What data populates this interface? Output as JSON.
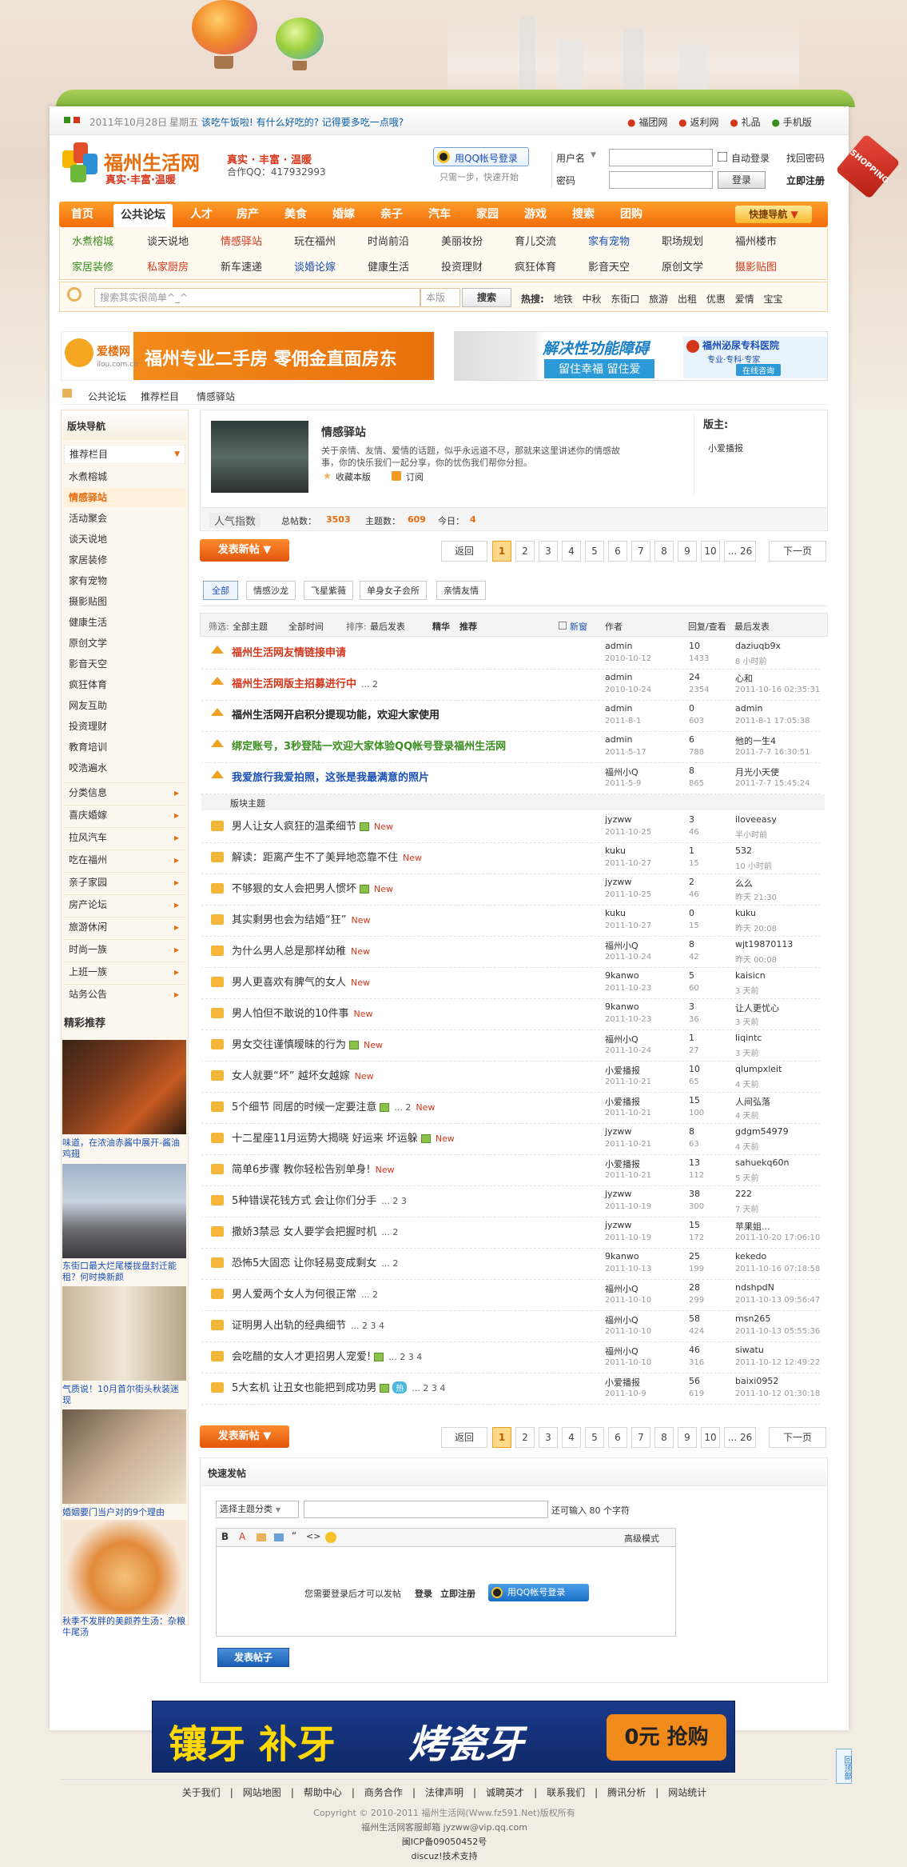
{
  "topbar": {
    "date": "2011年10月28日",
    "weekday": "星期五",
    "prompt": "该吃午饭啦! 有什么好吃的? 记得要多吃一点哦?",
    "links": [
      "福团网",
      "返利网",
      "礼品",
      "手机版"
    ]
  },
  "logo": {
    "name": "福州生活网",
    "slogan": "真实·丰富·温暖",
    "tagline": "真实 · 丰富 · 温暖",
    "qq": "合作QQ：417932993"
  },
  "qqlogin": {
    "label": "用QQ帐号登录",
    "sub": "只需一步，快速开始"
  },
  "login": {
    "username_label": "用户名",
    "password_label": "密码",
    "auto_login": "自动登录",
    "retrieve": "找回密码",
    "login_btn": "登录",
    "register": "立即注册"
  },
  "shopping_tag": "SHOPPING",
  "nav": {
    "tabs": [
      "首页",
      "公共论坛",
      "人才",
      "房产",
      "美食",
      "婚嫁",
      "亲子",
      "汽车",
      "家园",
      "游戏",
      "搜索",
      "团购"
    ],
    "quick": "快捷导航"
  },
  "subnav": [
    [
      "水煮榕城",
      "谈天说地",
      "情感驿站",
      "玩在福州",
      "时尚前沿",
      "美丽妆扮",
      "育儿交流",
      "家有宠物",
      "职场规划",
      "福州楼市"
    ],
    [
      "家居装修",
      "私家厨房",
      "新车速递",
      "谈婚论嫁",
      "健康生活",
      "投资理财",
      "疯狂体育",
      "影音天空",
      "原创文学",
      "摄影贴图"
    ]
  ],
  "search": {
    "placeholder": "搜索其实很简单^_^",
    "type": "本版",
    "button": "搜索",
    "hot_label": "热搜:",
    "hot": [
      "地铁",
      "中秋",
      "东街口",
      "旅游",
      "出租",
      "优惠",
      "爱情",
      "宝宝"
    ]
  },
  "ads": {
    "left_brand": "爱楼网",
    "left_domain": "ilou.com.cn",
    "left_text": "福州专业二手房 零佣金直面房东",
    "mid_text": "解决性功能障碍",
    "mid_sub": "留住幸福 留住爱",
    "right_text": "福州泌尿专科医院",
    "right_sub": "专业·专科·专家",
    "right_btn": "在线咨询"
  },
  "breadcrumb": [
    "公共论坛",
    "推荐栏目",
    "情感驿站"
  ],
  "sidebar": {
    "title": "版块导航",
    "group": "推荐栏目",
    "items": [
      "水煮榕城",
      "情感驿站",
      "活动聚会",
      "谈天说地",
      "家居装修",
      "家有宠物",
      "摄影贴图",
      "健康生活",
      "原创文学",
      "影音天空",
      "疯狂体育",
      "网友互助",
      "投资理财",
      "教育培训",
      "咬浩遍水"
    ],
    "groups": [
      "分类信息",
      "喜庆婚嫁",
      "拉风汽车",
      "吃在福州",
      "亲子家园",
      "房产论坛",
      "旅游休闲",
      "时尚一族",
      "上班一族",
      "站务公告"
    ],
    "featured_title": "精彩推荐",
    "featured": [
      "味道，在浓油赤酱中展开-酱油鸡翅",
      "东街口最大烂尾楼拢盘封迁能租？何时换新颜",
      "气质说！10月首尔街头秋装迷现",
      "婚姻要门当户对的9个理由",
      "秋季不发胖的美颜养生汤：杂粮牛尾汤"
    ]
  },
  "forum": {
    "name": "情感驿站",
    "desc": "关于亲情、友情、爱情的话题，似乎永远道不尽，那就来这里讲述你的情感故事，你的快乐我们一起分享，你的忧伤我们帮你分担。",
    "favorite": "收藏本版",
    "rss": "订阅",
    "moderator_label": "版主:",
    "moderator": "小爱播报",
    "popularity": "人气指数",
    "total_label": "总帖数：",
    "total": "3503",
    "topics_label": "主题数：",
    "topics": "609",
    "today_label": "今日：",
    "today": "4"
  },
  "post_btn": "发表新帖",
  "pager": {
    "back": "返回",
    "pages": [
      "1",
      "2",
      "3",
      "4",
      "5",
      "6",
      "7",
      "8",
      "9",
      "10",
      "... 26"
    ],
    "next": "下一页"
  },
  "filters": [
    "全部",
    "情感沙龙",
    "飞星紫薇",
    "单身女子会所",
    "亲情友情"
  ],
  "listhead": {
    "filter": "筛选:",
    "all_topics": "全部主题",
    "all_time": "全部时间",
    "sort": "排序:",
    "latest": "最后发表",
    "digest": "精华",
    "recommend": "推荐",
    "new_win": "新窗",
    "author": "作者",
    "replies": "回复/查看",
    "last": "最后发表"
  },
  "sticky": [
    {
      "title": "福州生活网友情链接申请",
      "color": "#d4361b",
      "author": "admin",
      "date": "2010-10-12",
      "r": "10",
      "v": "1433",
      "lu": "daziuqb9x",
      "lt": "8 小时前"
    },
    {
      "title": "福州生活网版主招募进行中",
      "color": "#d4361b",
      "pages": "... 2",
      "author": "admin",
      "date": "2010-10-24",
      "r": "24",
      "v": "2354",
      "lu": "心和",
      "lt": "2011-10-16 02:35:31"
    },
    {
      "title": "福州生活网开启积分提现功能，欢迎大家使用",
      "color": "#222",
      "author": "admin",
      "date": "2011-8-1",
      "r": "0",
      "v": "603",
      "lu": "admin",
      "lt": "2011-8-1 17:05:38"
    },
    {
      "title": "绑定账号，3秒登陆一欢迎大家体验QQ帐号登录福州生活网",
      "color": "#3a8d1f",
      "author": "admin",
      "date": "2011-5-17",
      "r": "6",
      "v": "788",
      "lu": "他的一生4",
      "lt": "2011-7-7 16:30:51"
    },
    {
      "title": "我爱旅行我爱拍照，这张是我最满意的照片",
      "color": "#1a4fb5",
      "author": "福州小Q",
      "date": "2011-5-9",
      "r": "8",
      "v": "865",
      "lu": "月光小天使",
      "lt": "2011-7-7 15:45:24"
    }
  ],
  "section_label": "版块主题",
  "threads": [
    {
      "title": "男人让女人疯狂的温柔细节",
      "img": true,
      "new": "New",
      "author": "jyzww",
      "date": "2011-10-25",
      "r": "3",
      "v": "46",
      "lu": "iloveeasy",
      "lt": "半小时前"
    },
    {
      "title": "解读：距离产生不了美异地恋靠不住",
      "new": "New",
      "author": "kuku",
      "date": "2011-10-27",
      "r": "1",
      "v": "15",
      "lu": "532",
      "lt": "10 小时前"
    },
    {
      "title": "不够狠的女人会把男人惯坏",
      "img": true,
      "new": "New",
      "author": "jyzww",
      "date": "2011-10-25",
      "r": "2",
      "v": "46",
      "lu": "么么",
      "lt": "昨天 21:30"
    },
    {
      "title": "其实剩男也会为结婚“狂”",
      "new": "New",
      "author": "kuku",
      "date": "2011-10-27",
      "r": "0",
      "v": "15",
      "lu": "kuku",
      "lt": "昨天 20:08"
    },
    {
      "title": "为什么男人总是那样幼稚",
      "new": "New",
      "author": "福州小Q",
      "date": "2011-10-24",
      "r": "8",
      "v": "42",
      "lu": "wjt19870113",
      "lt": "昨天 00:08"
    },
    {
      "title": "男人更喜欢有脾气的女人",
      "new": "New",
      "author": "9kanwo",
      "date": "2011-10-23",
      "r": "5",
      "v": "60",
      "lu": "kaisicn",
      "lt": "3 天前"
    },
    {
      "title": "男人怕但不敢说的10件事",
      "new": "New",
      "author": "9kanwo",
      "date": "2011-10-23",
      "r": "3",
      "v": "36",
      "lu": "让人更忧心",
      "lt": "3 天前"
    },
    {
      "title": "男女交往谨慎暧昧的行为",
      "img": true,
      "new": "New",
      "author": "福州小Q",
      "date": "2011-10-24",
      "r": "1",
      "v": "27",
      "lu": "liqintc",
      "lt": "3 天前"
    },
    {
      "title": "女人就要“坏” 越坏女越嫁",
      "new": "New",
      "author": "小爱播报",
      "date": "2011-10-21",
      "r": "10",
      "v": "65",
      "lu": "qlumpxleit",
      "lt": "4 天前"
    },
    {
      "title": "5个细节 同居的时候一定要注意",
      "img": true,
      "pages": "... 2",
      "new": "New",
      "author": "小爱播报",
      "date": "2011-10-21",
      "r": "15",
      "v": "100",
      "lu": "人间弘落",
      "lt": "4 天前"
    },
    {
      "title": "十二星座11月运势大揭晓 好运来 坏运躲",
      "img": true,
      "new": "New",
      "author": "jyzww",
      "date": "2011-10-21",
      "r": "8",
      "v": "63",
      "lu": "gdgm54979",
      "lt": "4 天前"
    },
    {
      "title": "简单6步骤 教你轻松告别单身!",
      "new": "New",
      "author": "小爱播报",
      "date": "2011-10-21",
      "r": "13",
      "v": "112",
      "lu": "sahuekq60n",
      "lt": "5 天前"
    },
    {
      "title": "5种错误花钱方式 会让你们分手",
      "pages": "... 2 3",
      "author": "jyzww",
      "date": "2011-10-19",
      "r": "38",
      "v": "300",
      "lu": "222",
      "lt": "7 天前"
    },
    {
      "title": "撒娇3禁忌 女人要学会把握时机",
      "pages": "... 2",
      "author": "jyzww",
      "date": "2011-10-19",
      "r": "15",
      "v": "172",
      "lu": "苹果姐...",
      "lt": "2011-10-20 17:06:10"
    },
    {
      "title": "恐怖5大固恋 让你轻易变成剩女",
      "pages": "... 2",
      "author": "9kanwo",
      "date": "2011-10-13",
      "r": "25",
      "v": "199",
      "lu": "kekedo",
      "lt": "2011-10-16 07:18:58"
    },
    {
      "title": "男人爱两个女人为何很正常",
      "pages": "... 2",
      "author": "福州小Q",
      "date": "2011-10-10",
      "r": "28",
      "v": "299",
      "lu": "ndshpdN",
      "lt": "2011-10-13 09:56:47"
    },
    {
      "title": "证明男人出轨的经典细节",
      "pages": "... 2 3 4",
      "author": "福州小Q",
      "date": "2011-10-10",
      "r": "58",
      "v": "424",
      "lu": "msn265",
      "lt": "2011-10-13 05:55:36"
    },
    {
      "title": "会吃醋的女人才更招男人宠爱!",
      "img": true,
      "pages": "... 2 3 4",
      "author": "福州小Q",
      "date": "2011-10-10",
      "r": "46",
      "v": "316",
      "lu": "siwatu",
      "lt": "2011-10-12 12:49:22"
    },
    {
      "title": "5大玄机 让丑女也能把到成功男",
      "img": true,
      "hot": "热",
      "pages": "... 2 3 4",
      "author": "小爱播报",
      "date": "2011-10-9",
      "r": "56",
      "v": "619",
      "lu": "baixi0952",
      "lt": "2011-10-12 01:30:18"
    }
  ],
  "quickpost": {
    "title": "快速发帖",
    "category": "选择主题分类",
    "remain_prefix": "还可输入",
    "remain": "80",
    "remain_suffix": "个字符",
    "advanced": "高级模式",
    "need_login": "您需要登录后才可以发帖",
    "login": "登录",
    "register": "立即注册",
    "qq": "用QQ帐号登录",
    "submit": "发表帖子"
  },
  "bottom_ad": {
    "text1": "镶牙 补牙",
    "text2": "烤瓷牙",
    "btn": "0元 抢购"
  },
  "backtop": "回顶部",
  "footer": {
    "links": [
      "关于我们",
      "网站地图",
      "帮助中心",
      "商务合作",
      "法律声明",
      "诚聘英才",
      "联系我们",
      "腾讯分析",
      "网站统计"
    ],
    "copyright": "Copyright © 2010-2011 福州生活网(Www.fz591.Net)版权所有",
    "email": "福州生活网客服邮箱 jyzww@vip.qq.com",
    "icp": "闽ICP备09050452号",
    "support": "discuz!技术支持"
  },
  "colors": {
    "orange": "#f26c0a",
    "blue": "#0a5fa8",
    "red": "#d4361b"
  }
}
